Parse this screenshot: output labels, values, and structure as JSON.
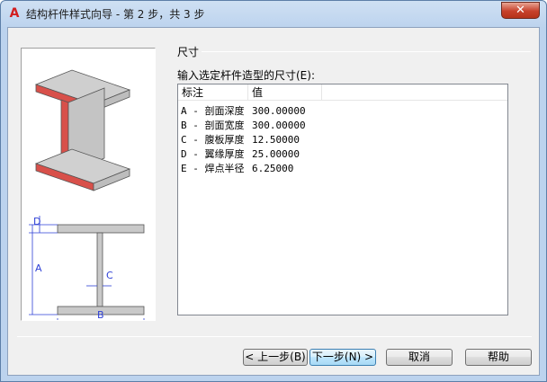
{
  "window": {
    "title": "结构杆件样式向导 - 第 2 步，共 3 步",
    "close_glyph": "✕",
    "app_icon_glyph": "A"
  },
  "main": {
    "section_title": "尺寸",
    "prompt": "输入选定杆件造型的尺寸(E):",
    "columns": [
      "标注",
      "值",
      ""
    ],
    "rows": [
      {
        "label": "A - 剖面深度",
        "value": "300.00000"
      },
      {
        "label": "B - 剖面宽度",
        "value": "300.00000"
      },
      {
        "label": "C - 腹板厚度",
        "value": "12.50000"
      },
      {
        "label": "D - 翼缘厚度",
        "value": "25.00000"
      },
      {
        "label": "E - 焊点半径",
        "value": "6.25000"
      }
    ]
  },
  "diagram": {
    "labels": {
      "a": "A",
      "b": "B",
      "c": "C",
      "d": "D"
    },
    "colors": {
      "flange_edge": "#d8504a",
      "dimension": "#2d3fd6",
      "steel": "#c9c9c9"
    }
  },
  "buttons": {
    "back": "< 上一步(B)",
    "next": "下一步(N) >",
    "cancel": "取消",
    "help": "帮助"
  }
}
